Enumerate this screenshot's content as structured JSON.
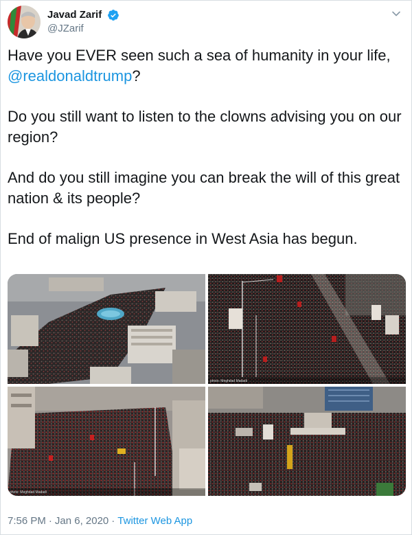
{
  "author": {
    "display_name": "Javad Zarif",
    "handle": "@JZarif",
    "verified": true
  },
  "tweet": {
    "line1_before": "Have you EVER seen such a sea of humanity in your life,",
    "mention": "@realdonaldtrump",
    "line1_after": "?",
    "p2": "Do you still want to listen to the clowns advising you on our region?",
    "p3": "And do you still imagine you can break the will of this great nation & its people?",
    "p4": "End of malign US presence in West Asia has begun."
  },
  "media": {
    "photo_credit": "photo: Meghdad Madadi"
  },
  "footer": {
    "time": "7:56 PM",
    "separator": "·",
    "date": "Jan 6, 2020",
    "source": "Twitter Web App"
  },
  "colors": {
    "link": "#1b95e0",
    "muted": "#657786",
    "verified_badge": "#1da1f2"
  }
}
